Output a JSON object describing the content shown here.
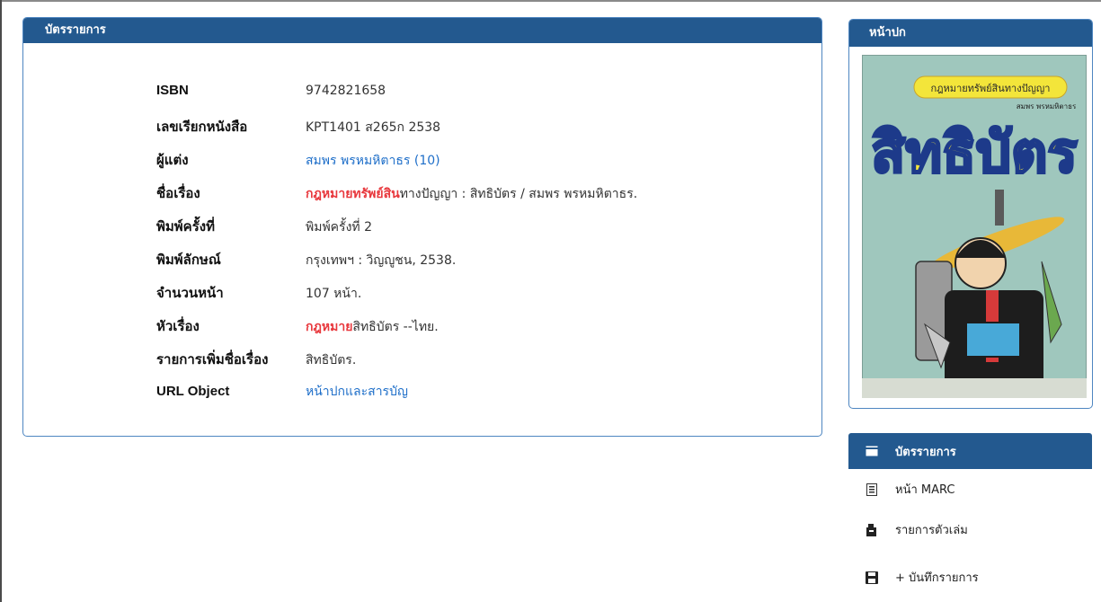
{
  "catalog_card": {
    "title": "บัตรรายการ",
    "rows": [
      {
        "label": "ISBN",
        "value": "9742821658"
      },
      {
        "label": "เลขเรียกหนังสือ",
        "value": "KPT1401 ส265ก 2538"
      },
      {
        "label": "ผู้แต่ง",
        "value": "สมพร พรหมหิตาธร (10)"
      },
      {
        "label": "ชื่อเรื่อง",
        "value_highlight": "กฎหมายทรัพย์สิน",
        "value_rest": "ทางปัญญา : สิทธิบัตร / สมพร พรหมหิตาธร."
      },
      {
        "label": "พิมพ์ครั้งที่",
        "value": "พิมพ์ครั้งที่ 2"
      },
      {
        "label": "พิมพ์ลักษณ์",
        "value": "กรุงเทพฯ : วิญญูชน, 2538."
      },
      {
        "label": "จำนวนหน้า",
        "value": "107 หน้า."
      },
      {
        "label": "หัวเรื่อง",
        "value_highlight": "กฎหมาย",
        "value_rest": "สิทธิบัตร --ไทย."
      },
      {
        "label": "รายการเพิ่มชื่อเรื่อง",
        "value": "สิทธิบัตร."
      },
      {
        "label": "URL Object",
        "value": "หน้าปกและสารบัญ"
      }
    ]
  },
  "cover": {
    "title": "หน้าปก",
    "book_banner": "กฎหมายทรัพย์สินทางปัญญา",
    "book_title": "สิทธิบัตร",
    "book_author": "สมพร พรหมหิตาธร"
  },
  "menu": {
    "items": [
      {
        "label": "บัตรรายการ",
        "icon": "card-icon"
      },
      {
        "label": "หน้า MARC",
        "icon": "marc-icon"
      },
      {
        "label": "รายการตัวเล่ม",
        "icon": "items-icon"
      },
      {
        "label": "+ บันทึกรายการ",
        "icon": "save-icon"
      }
    ]
  },
  "colors": {
    "header": "#23598f",
    "link": "#1f6fc9",
    "highlight": "#e8383d"
  }
}
